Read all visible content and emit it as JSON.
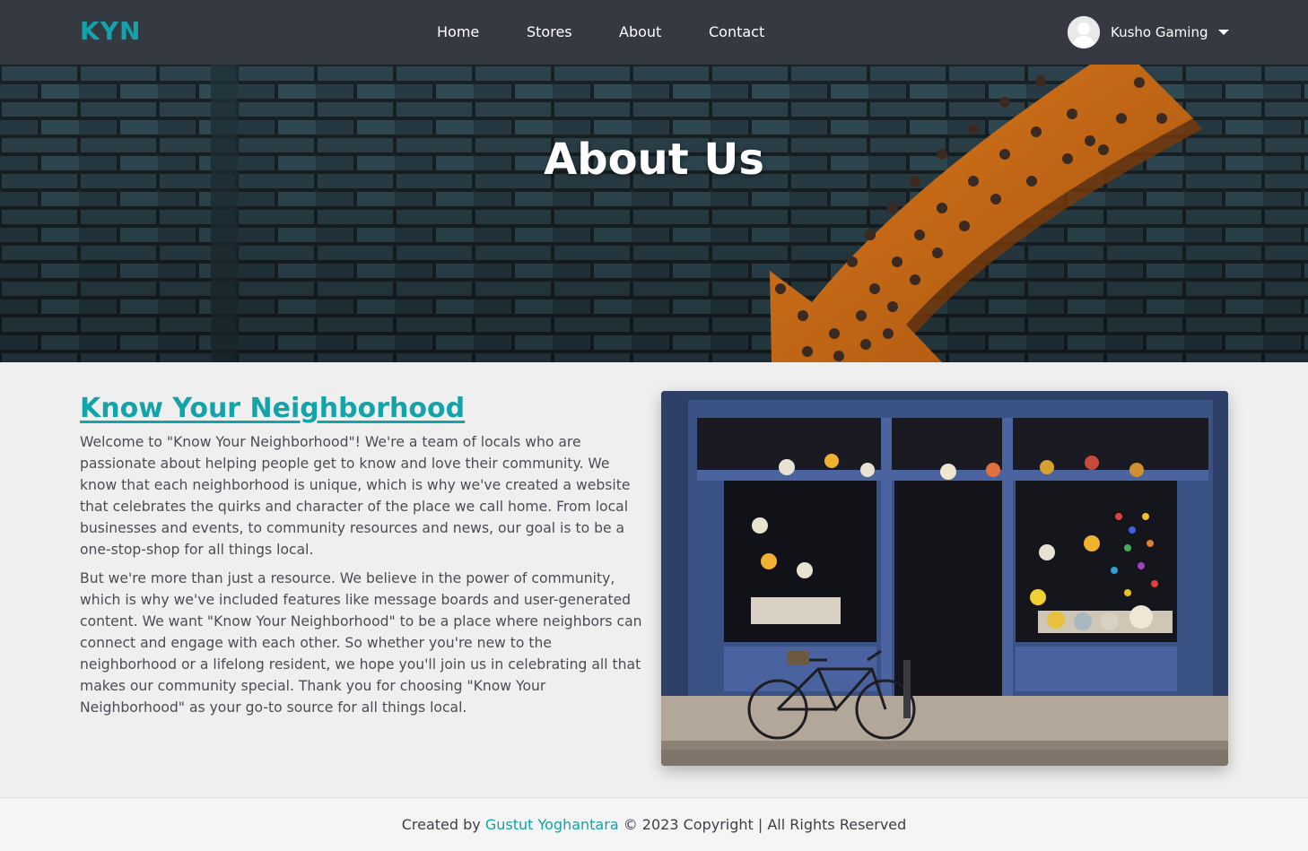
{
  "navbar": {
    "logo": "KYN",
    "links": [
      {
        "label": "Home"
      },
      {
        "label": "Stores"
      },
      {
        "label": "About"
      },
      {
        "label": "Contact"
      }
    ],
    "user": {
      "name": "Kusho Gaming",
      "avatar_icon": "user-avatar-icon",
      "menu_icon": "caret-down-icon"
    }
  },
  "hero": {
    "title": "About Us"
  },
  "about": {
    "heading": "Know Your Neighborhood",
    "paragraphs": [
      "Welcome to \"Know Your Neighborhood\"! We're a team of locals who are passionate about helping people get to know and love their community. We know that each neighborhood is unique, which is why we've created a website that celebrates the quirks and character of the place we call home. From local businesses and events, to community resources and news, our goal is to be a one-stop-shop for all things local.",
      "But we're more than just a resource. We believe in the power of community, which is why we've included features like message boards and user-generated content. We want \"Know Your Neighborhood\" to be a place where neighbors can connect and engage with each other. So whether you're new to the neighborhood or a lifelong resident, we hope you'll join us in celebrating all that makes our community special. Thank you for choosing \"Know Your Neighborhood\" as your go-to source for all things local."
    ]
  },
  "footer": {
    "prefix": "Created by",
    "author": "Gustut Yoghantara",
    "suffix": "© 2023 Copyright | All Rights Reserved"
  },
  "colors": {
    "accent": "#13a3a8",
    "navbar_bg": "#353941",
    "page_bg": "#efefef"
  }
}
